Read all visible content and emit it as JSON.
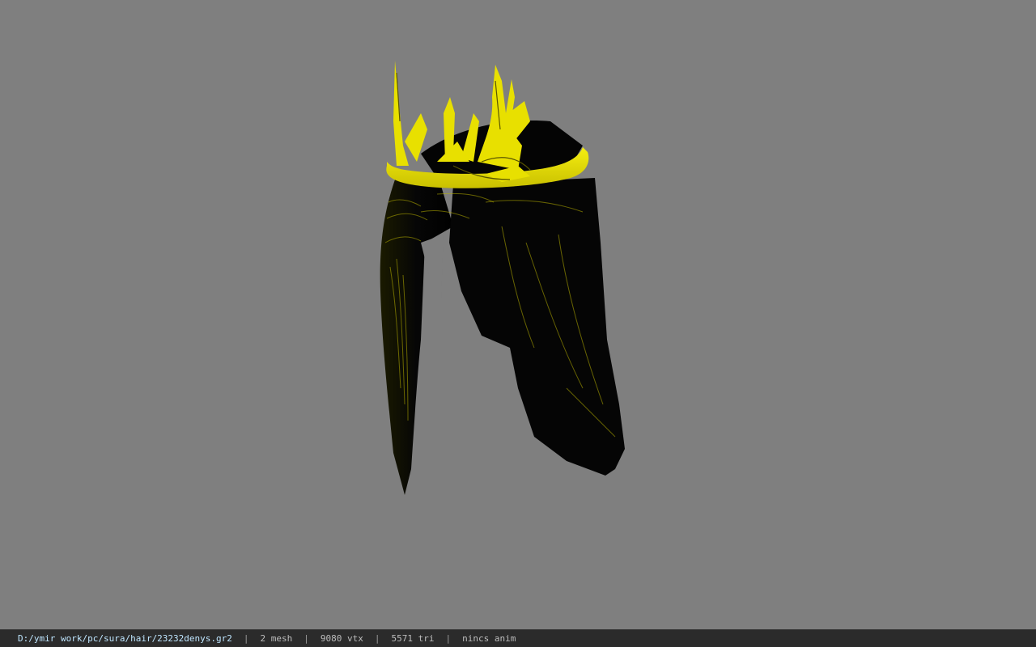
{
  "viewport": {
    "background_color": "#7f7f7f",
    "model": {
      "hair_color": "#050505",
      "hair_highlight_color": "#c8c000",
      "crown_color": "#e8e000",
      "crown_shadow_color": "#8a8500"
    }
  },
  "statusbar": {
    "file_path": "D:/ymir work/pc/sura/hair/23232denys.gr2",
    "separator": "|",
    "mesh_count": "2 mesh",
    "vertex_count": "9080 vtx",
    "triangle_count": "5571 tri",
    "animation_info": "nincs anim"
  }
}
